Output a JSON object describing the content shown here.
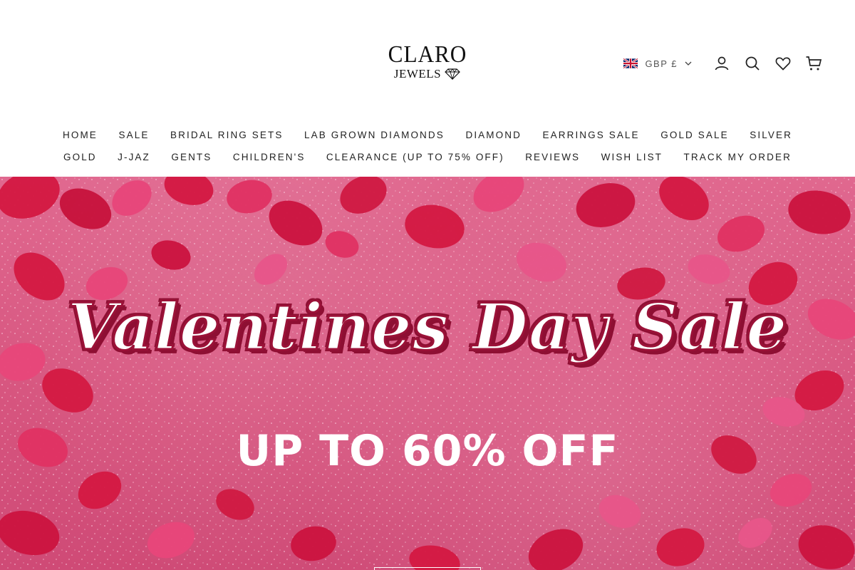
{
  "brand": {
    "logo_top": "CLARO",
    "logo_bottom": "JEWELS"
  },
  "header": {
    "currency_label": "GBP £",
    "flag_icon": "uk-flag-icon",
    "icons": [
      "account-icon",
      "search-icon",
      "wishlist-heart-icon",
      "cart-icon"
    ]
  },
  "nav": {
    "row1": [
      "HOME",
      "SALE",
      "BRIDAL RING SETS",
      "LAB GROWN DIAMONDS",
      "DIAMOND",
      "EARRINGS SALE",
      "GOLD SALE",
      "SILVER"
    ],
    "row2": [
      "GOLD",
      "J-JAZ",
      "GENTS",
      "CHILDREN'S",
      "CLEARANCE (UP TO 75% OFF)",
      "REVIEWS",
      "WISH LIST",
      "TRACK MY ORDER"
    ]
  },
  "hero": {
    "title": "Valentines Day Sale",
    "subtitle": "UP TO 60% OFF",
    "colors": {
      "background": "#d7557f",
      "title_outline": "#9b1238",
      "petal": "#d8163f"
    }
  }
}
